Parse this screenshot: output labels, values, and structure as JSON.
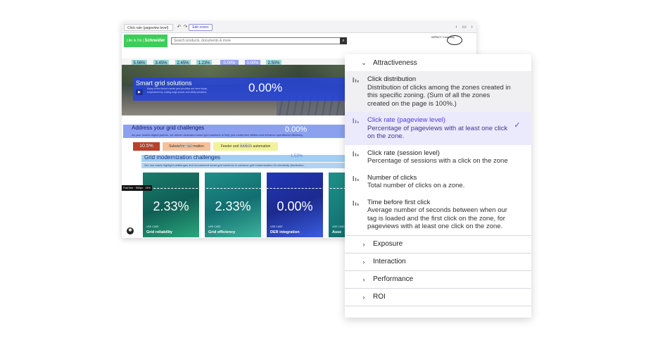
{
  "browser": {
    "zoning_select": "Click rate (pageview level)",
    "edit_zones": "Edit zones",
    "undo_icon": "↶",
    "redo_icon": "↷",
    "back_icon": "‹",
    "forward_icon": "›",
    "layout_icon": "▭"
  },
  "site": {
    "logo_life": "Life Is On",
    "logo_brand": "Schneider",
    "search_placeholder": "Search products, documents & more",
    "impact_text": "IMPACT Company",
    "nav_values": [
      "5.56%",
      "3.45%",
      "2.45%",
      "1.23%",
      "0.00%",
      "0.00%",
      "2.50%"
    ],
    "hero": {
      "title": "Smart grid solutions",
      "text": "Many of the future's smart grid priorities are here today, empowered by cutting-edge power and utility solutions.",
      "pct": "0.00%"
    },
    "address": {
      "title": "Address your grid challenges",
      "subtitle": "As your trusted digital partner, we deliver dedicated smart grid solutions to help you modernize utilities and enhance operational efficiency.",
      "pct": "0.00%"
    },
    "tabs": [
      {
        "label": "Grid modern",
        "pct": "10.5%"
      },
      {
        "label": "Substation automation",
        "pct": "2.12%"
      },
      {
        "label": "Feeder and network automation",
        "pct": "0.0%"
      }
    ],
    "grid_mod": {
      "title": "Grid modernization challenges",
      "pct": "1.53%",
      "subtitle": "Our use cases highlight challenges and recommend smart grid solutions to advance grid modernization for electricity distribution."
    },
    "fold_label": "Fold line · 900px · 21%",
    "cards": [
      {
        "pct": "2.33%",
        "tag": "USE CASE",
        "name": "Grid reliability"
      },
      {
        "pct": "2.33%",
        "tag": "USE CASE",
        "name": "Grid efficiency"
      },
      {
        "pct": "0.00%",
        "tag": "USE CASE",
        "name": "DER integration"
      },
      {
        "pct": "",
        "tag": "USE CASE",
        "name": "Asse"
      }
    ],
    "accessibility_icon": "✱"
  },
  "panel": {
    "attractiveness": "Attractiveness",
    "metrics": [
      {
        "title": "Click distribution",
        "desc": "Distribution of clicks among the zones created in this specific zoning. (Sum of all the zones created on the page is 100%.)"
      },
      {
        "title": "Click rate (pageview level)",
        "desc": "Percentage of pageviews with at least one click on the zone."
      },
      {
        "title": "Click rate (session level)",
        "desc": "Percentage of sessions with a click on the zone"
      },
      {
        "title": "Number of clicks",
        "desc": "Total number of clicks on a zone."
      },
      {
        "title": "Time before first click",
        "desc": "Average number of seconds between when our tag is loaded and the first click on the zone, for pageviews with at least one click on the zone."
      }
    ],
    "sections": [
      "Exposure",
      "Interaction",
      "Performance",
      "ROI"
    ],
    "selected_index": 1
  },
  "colors": {
    "accent": "#4c3cdc",
    "selected_bg": "#ebe9fc",
    "brand_green": "#3dcd58",
    "zone_blue": "#2644dc"
  }
}
